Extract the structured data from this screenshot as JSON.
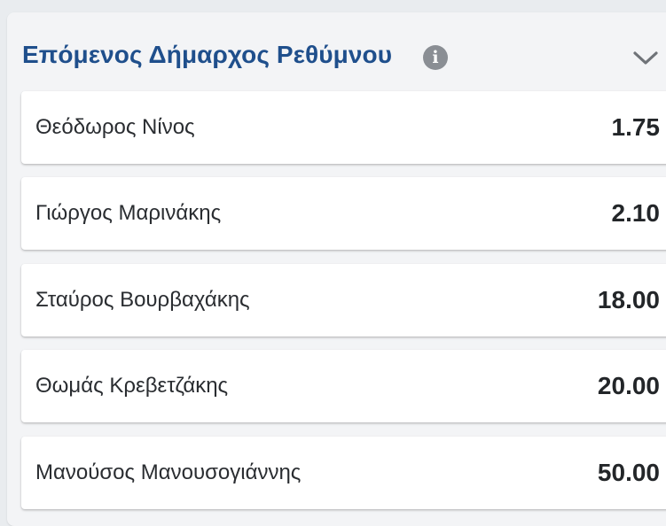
{
  "market": {
    "title": "Επόμενος Δήμαρχος Ρεθύμνου",
    "info_icon": "info-icon",
    "collapse_icon": "chevron-down-icon",
    "title_color": "#1f4f8c"
  },
  "selections": [
    {
      "name": "Θεόδωρος Νίνος",
      "odds": "1.75"
    },
    {
      "name": "Γιώργος Μαρινάκης",
      "odds": "2.10"
    },
    {
      "name": "Σταύρος Βουρβαχάκης",
      "odds": "18.00"
    },
    {
      "name": "Θωμάς Κρεβετζάκης",
      "odds": "20.00"
    },
    {
      "name": "Μανούσος Μανουσογιάννης",
      "odds": "50.00"
    }
  ]
}
